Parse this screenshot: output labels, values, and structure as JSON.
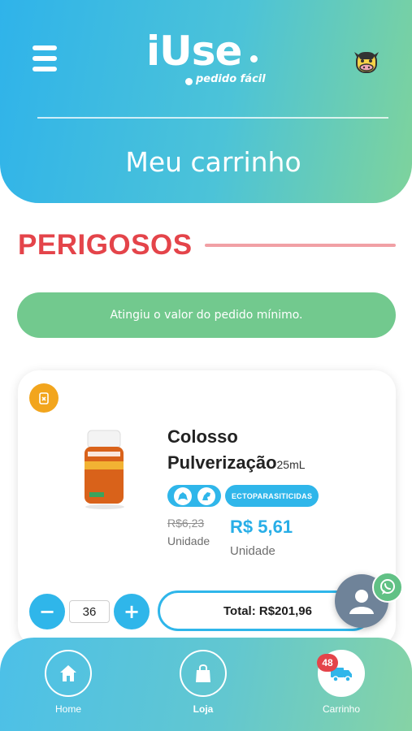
{
  "header": {
    "logo_text": "iUse",
    "logo_subtitle": "pedido fácil",
    "title": "Meu carrinho",
    "menu_icon": "hamburger-menu-icon",
    "profile_icon": "cow-icon"
  },
  "section": {
    "title": "PERIGOSOS",
    "min_order_message": "Atingiu o valor do pedido mínimo."
  },
  "product": {
    "name": "Colosso Pulverização",
    "size": "25mL",
    "category_badge": "ECTOPARASITICIDAS",
    "species_icons": [
      "bovine-icon",
      "equine-icon"
    ],
    "old_price": "R$6,23",
    "old_price_unit": "Unidade",
    "price": "R$ 5,61",
    "price_unit": "Unidade",
    "quantity": "36",
    "total_label": "Total: R$201,96"
  },
  "bottom_nav": {
    "items": [
      {
        "label": "Home",
        "icon": "home-icon"
      },
      {
        "label": "Loja",
        "icon": "shopping-bag-icon"
      },
      {
        "label": "Carrinho",
        "icon": "truck-icon"
      }
    ],
    "cart_count": "48"
  },
  "colors": {
    "primary_blue": "#2fb6ea",
    "green": "#72c98e",
    "danger_red": "#e4444a",
    "remove_orange": "#f2a51d"
  }
}
